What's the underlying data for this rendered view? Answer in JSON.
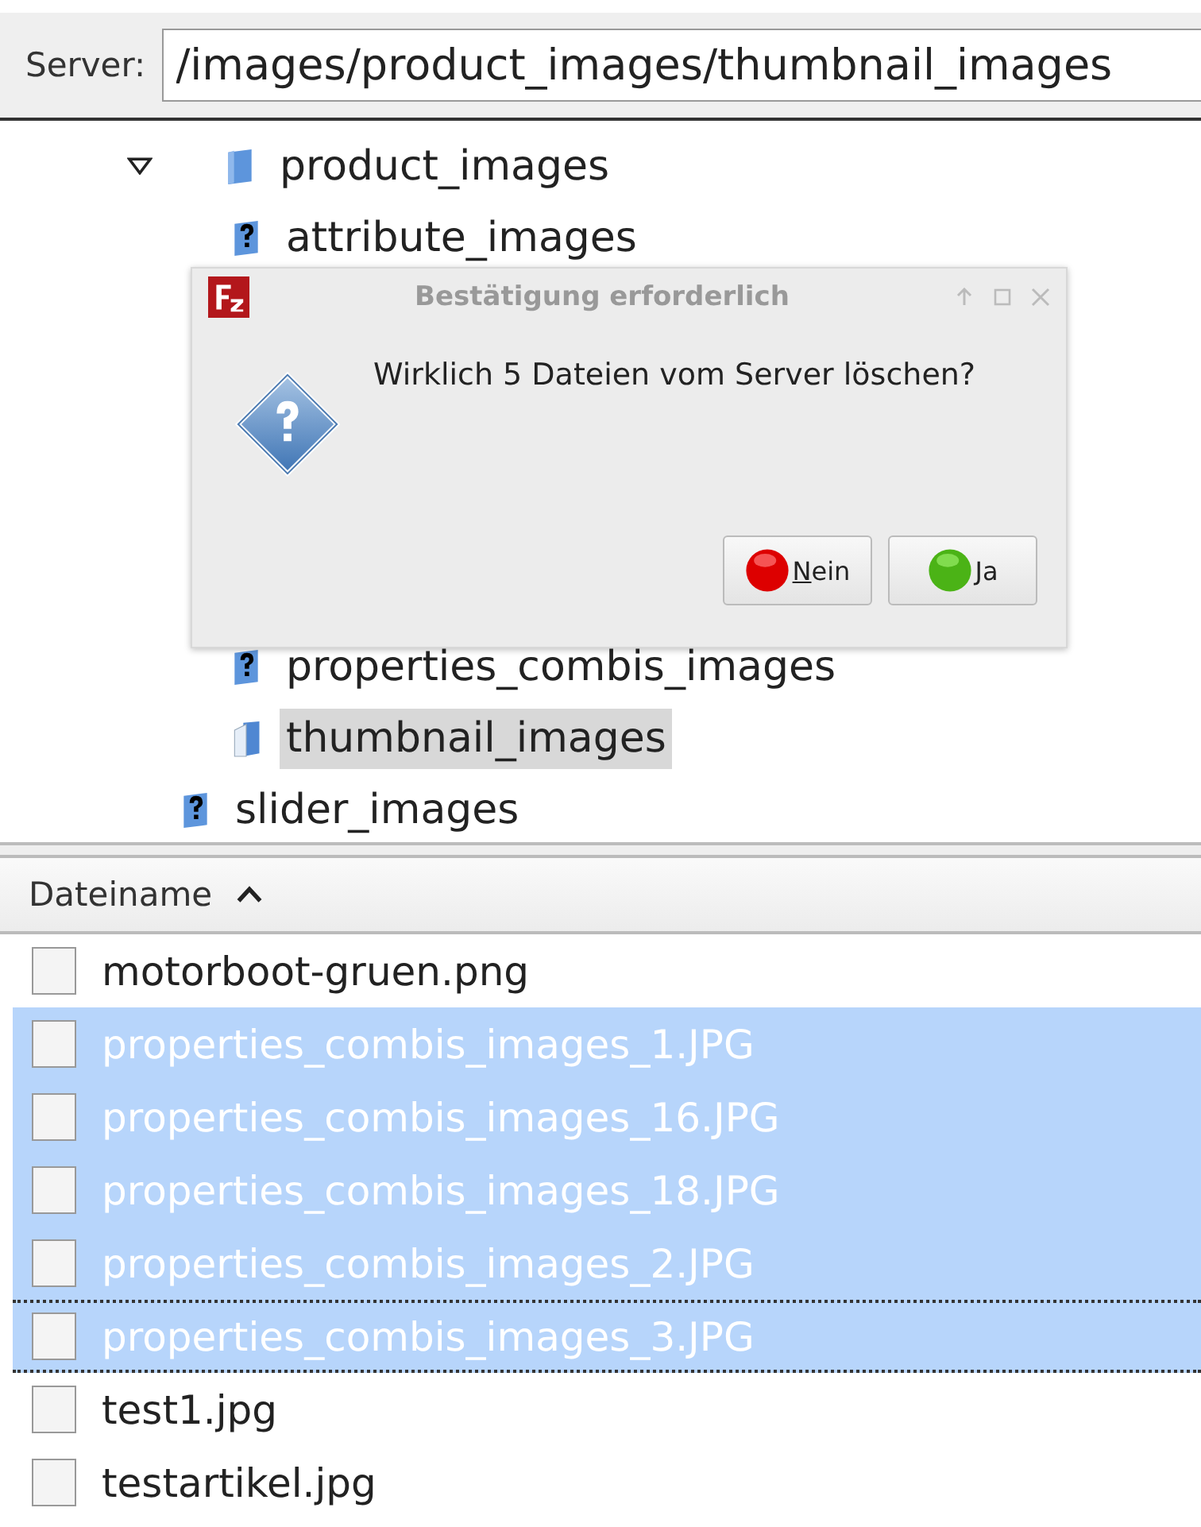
{
  "server_bar": {
    "label": "Server:",
    "path": "/images/product_images/thumbnail_images"
  },
  "tree": [
    {
      "name": "product_images",
      "kind": "folder",
      "expanded": true,
      "selected": false,
      "children": [
        {
          "name": "attribute_images",
          "kind": "unknown",
          "selected": false
        },
        {
          "name": "properties_combis_images",
          "kind": "unknown",
          "selected": false
        },
        {
          "name": "thumbnail_images",
          "kind": "folder-open",
          "selected": true
        }
      ]
    },
    {
      "name": "slider_images",
      "kind": "unknown",
      "selected": false
    }
  ],
  "dialog": {
    "title": "Bestätigung erforderlich",
    "message": "Wirklich 5 Dateien vom Server löschen?",
    "buttons": [
      {
        "label": "Nein",
        "kind": "no"
      },
      {
        "label": "Ja",
        "kind": "yes"
      }
    ]
  },
  "file_list": {
    "column": "Dateiname",
    "sort_ascending": true,
    "rows": [
      {
        "name": "motorboot-gruen.png",
        "selected": false,
        "focused": false
      },
      {
        "name": "properties_combis_images_1.JPG",
        "selected": true,
        "focused": false
      },
      {
        "name": "properties_combis_images_16.JPG",
        "selected": true,
        "focused": false
      },
      {
        "name": "properties_combis_images_18.JPG",
        "selected": true,
        "focused": false
      },
      {
        "name": "properties_combis_images_2.JPG",
        "selected": true,
        "focused": false
      },
      {
        "name": "properties_combis_images_3.JPG",
        "selected": true,
        "focused": true
      },
      {
        "name": "test1.jpg",
        "selected": false,
        "focused": false
      },
      {
        "name": "testartikel.jpg",
        "selected": false,
        "focused": false
      }
    ]
  }
}
